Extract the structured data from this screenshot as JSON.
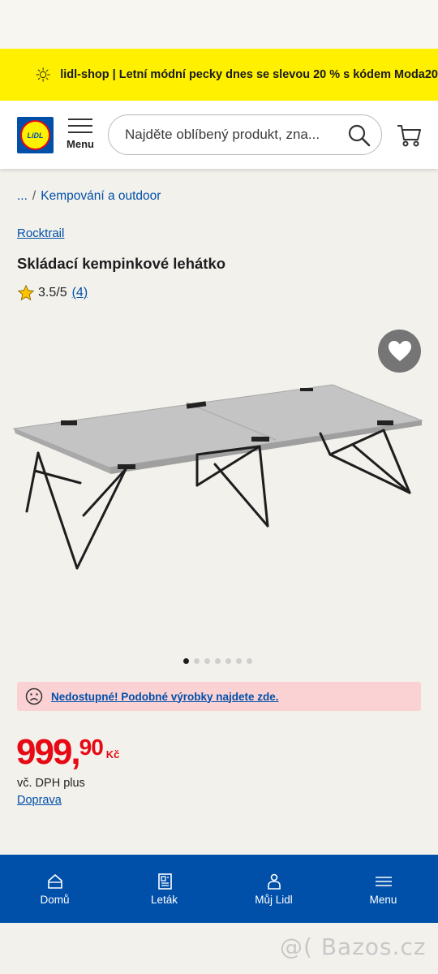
{
  "promo": {
    "text": "lidl-shop | Letní módní pecky dnes se slevou 20 % s kódem Moda20",
    "icon": "sun-icon",
    "bg": "#fff000"
  },
  "header": {
    "logo_text": "LiDL",
    "menu_label": "Menu",
    "search_placeholder": "Najděte oblíbený produkt, zna...",
    "search_icon": "search-icon",
    "cart_icon": "cart-icon"
  },
  "breadcrumb": {
    "ellipsis": "...",
    "separator": "/",
    "category": "Kempování a outdoor"
  },
  "product": {
    "brand": "Rocktrail",
    "title": "Skládací kempinkové lehátko",
    "rating": "3.5/5",
    "rating_count": "(4)",
    "image_dots_total": 7,
    "image_dots_active": 1
  },
  "alert": {
    "text": "Nedostupné! Podobné výrobky najdete zde.",
    "icon": "sad-face-icon",
    "bg": "#fbd2d4"
  },
  "price": {
    "integer": "999,",
    "decimal": "90",
    "currency": "Kč",
    "color": "#e60a14"
  },
  "vat_text": "vč. DPH plus",
  "shipping_link": "Doprava",
  "bottom_nav": {
    "items": [
      {
        "label": "Domů",
        "icon": "home-icon"
      },
      {
        "label": "Leták",
        "icon": "leaflet-icon"
      },
      {
        "label": "Můj Lidl",
        "icon": "user-icon"
      },
      {
        "label": "Menu",
        "icon": "hamburger-icon"
      }
    ],
    "bg": "#0050aa"
  },
  "watermark": "@( Bazos.cz"
}
